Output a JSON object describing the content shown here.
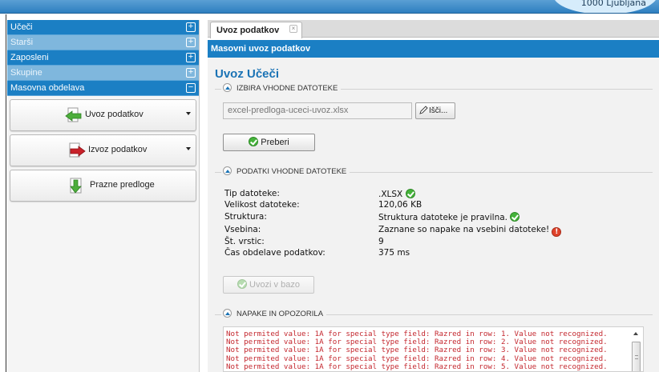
{
  "header": {
    "city": "1000 Ljubljana"
  },
  "sidebar": {
    "sections": [
      {
        "label": "Učeči",
        "toggle": "+"
      },
      {
        "label": "Starši",
        "toggle": "+"
      },
      {
        "label": "Zaposleni",
        "toggle": "+"
      },
      {
        "label": "Skupine",
        "toggle": "+"
      },
      {
        "label": "Masovna obdelava",
        "toggle": "−"
      }
    ],
    "actions": [
      {
        "label": "Uvoz podatkov",
        "icon": "arrow-left-green-icon"
      },
      {
        "label": "Izvoz podatkov",
        "icon": "arrow-right-red-icon"
      },
      {
        "label": "Prazne predloge",
        "icon": "arrow-down-green-icon"
      }
    ]
  },
  "main": {
    "tab_label": "Uvoz podatkov",
    "tab_close": "×",
    "panel_title": "Masovni uvoz podatkov",
    "page_title": "Uvoz Učeči",
    "section_file": "IZBIRA VHODNE DATOTEKE",
    "file_value": "excel-predloga-uceci-uvoz.xlsx",
    "browse_label": "Išči...",
    "read_button": "Preberi",
    "section_data": "PODATKI VHODNE DATOTEKE",
    "info": [
      {
        "label": "Tip datoteke:",
        "value": ".XLSX"
      },
      {
        "label": "Velikost datoteke:",
        "value": "120,06 KB"
      },
      {
        "label": "Struktura:",
        "value": "Struktura datoteke je pravilna."
      },
      {
        "label": "Vsebina:",
        "value": "Zaznane so napake na vsebini datoteke!"
      },
      {
        "label": "Št. vrstic:",
        "value": "9"
      },
      {
        "label": "Čas obdelave podatkov:",
        "value": "375 ms"
      }
    ],
    "import_button": "Uvozi v bazo",
    "section_errors": "NAPAKE IN OPOZORILA",
    "errors": [
      "Not permited value: 1A for special type field: Razred in row: 1. Value not recognized.",
      "Not permited value: 1A for special type field: Razred in row: 2. Value not recognized.",
      "Not permited value: 1A for special type field: Razred in row: 3. Value not recognized.",
      "Not permited value: 1A for special type field: Razred in row: 4. Value not recognized.",
      "Not permited value: 1A for special type field: Razred in row: 5. Value not recognized."
    ]
  }
}
